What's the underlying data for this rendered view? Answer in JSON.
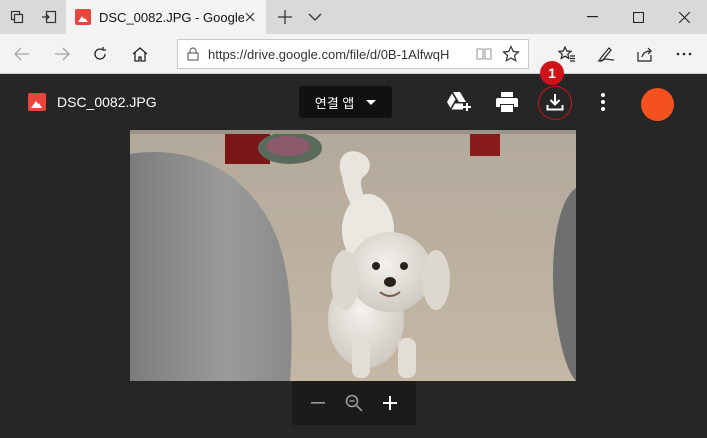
{
  "browser": {
    "tab": {
      "title": "DSC_0082.JPG - Google"
    },
    "address_bar": {
      "url": "https://drive.google.com/file/d/0B-1AlfwqH"
    }
  },
  "viewer": {
    "file_name": "DSC_0082.JPG",
    "open_with_label": "연결 앱",
    "badge_number": "1",
    "avatar_color": "#f4511e",
    "photo_subject": "white poodle"
  }
}
